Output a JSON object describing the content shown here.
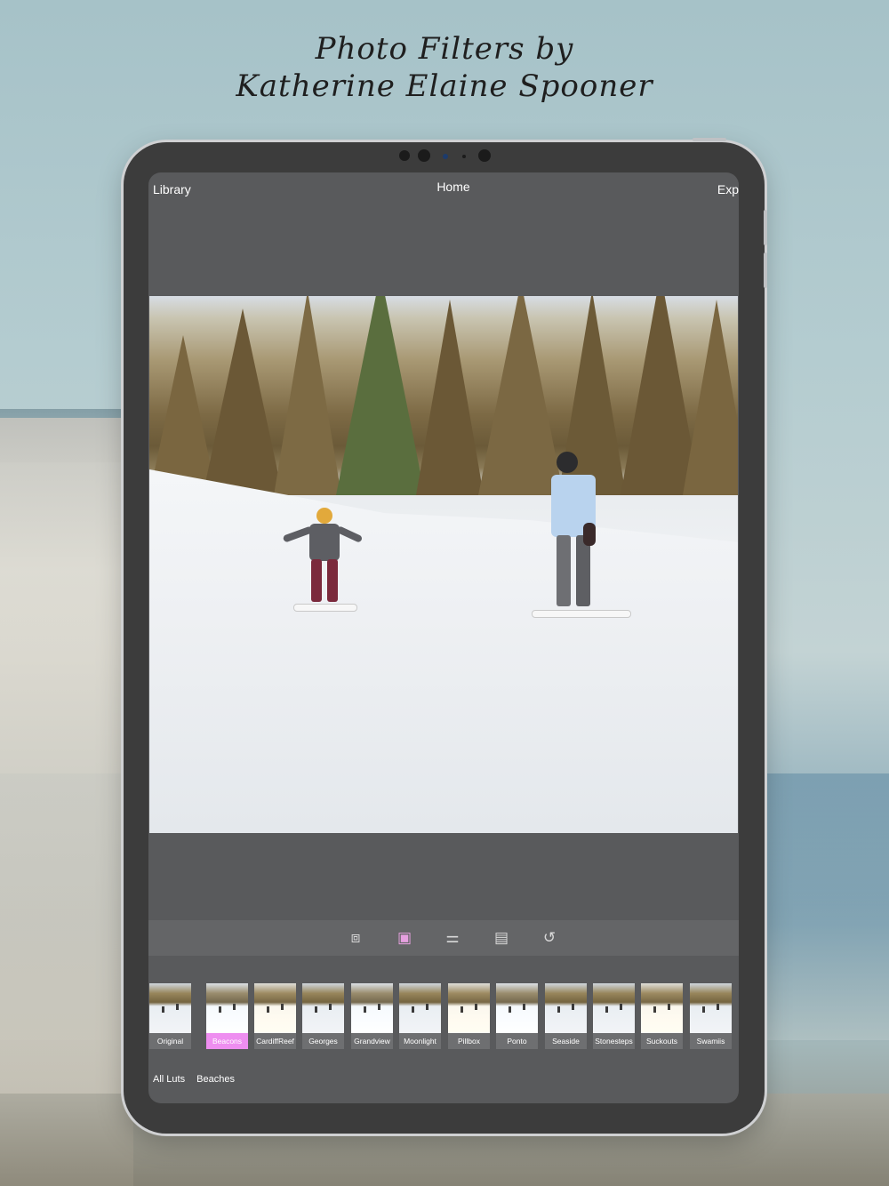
{
  "headline": {
    "line1": "Photo Filters by",
    "line2": "Katherine Elaine Spooner"
  },
  "nav": {
    "left": "Library",
    "center": "Home",
    "right": "Exp"
  },
  "toolbar": {
    "tools": [
      {
        "name": "crop-icon",
        "glyph": "⧈"
      },
      {
        "name": "filter-icon",
        "glyph": "▣",
        "active": true
      },
      {
        "name": "adjust-icon",
        "glyph": "⚌"
      },
      {
        "name": "clipboard-icon",
        "glyph": "▤"
      },
      {
        "name": "history-icon",
        "glyph": "↺"
      }
    ]
  },
  "filters": {
    "selected": "Beacons",
    "items": [
      "Original",
      "Beacons",
      "CardiffReef",
      "Georges",
      "Grandview",
      "Moonlight",
      "Pillbox",
      "Ponto",
      "Seaside",
      "Stonesteps",
      "Suckouts",
      "Swamiis"
    ]
  },
  "bottom_tabs": [
    "All Luts",
    "Beaches"
  ],
  "colors": {
    "accent": "#ee8ef0",
    "screen_bg": "#595a5c",
    "device": "#3c3c3c"
  }
}
